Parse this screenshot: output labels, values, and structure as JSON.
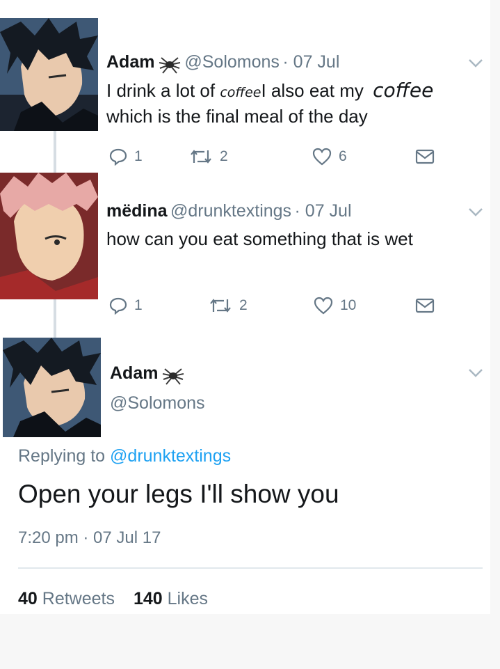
{
  "thread": [
    {
      "name": "Adam",
      "handle": "@Solomons",
      "date": "· 07 Jul",
      "text_part1": "I drink a lot of ",
      "text_overlay_small": "coffee",
      "text_part2": "I also eat my ",
      "text_overlay_large": "coffee",
      "text_line2": "which is the final meal of the day",
      "replies": "1",
      "retweets": "2",
      "likes": "6"
    },
    {
      "name": "mëdina",
      "handle": "@drunktextings",
      "date": "· 07 Jul",
      "text": "how can you eat something that is wet",
      "replies": "1",
      "retweets": "2",
      "likes": "10"
    }
  ],
  "focus_tweet": {
    "name": "Adam",
    "handle": "@Solomons",
    "replying_prefix": "Replying to",
    "replying_handle": "@drunktextings",
    "text": "Open your legs I'll show you",
    "timestamp": "7:20 pm · 07 Jul 17",
    "retweet_count": "40",
    "retweet_label": "Retweets",
    "like_count": "140",
    "like_label": "Likes"
  },
  "icons": {
    "reply": "reply-icon",
    "retweet": "retweet-icon",
    "like": "heart-icon",
    "dm": "envelope-icon",
    "more": "chevron-down-icon",
    "badge": "spider-emoji-icon"
  },
  "colors": {
    "text": "#14171a",
    "muted": "#657786",
    "link": "#1da1f2",
    "divider": "#e1e8ed"
  }
}
